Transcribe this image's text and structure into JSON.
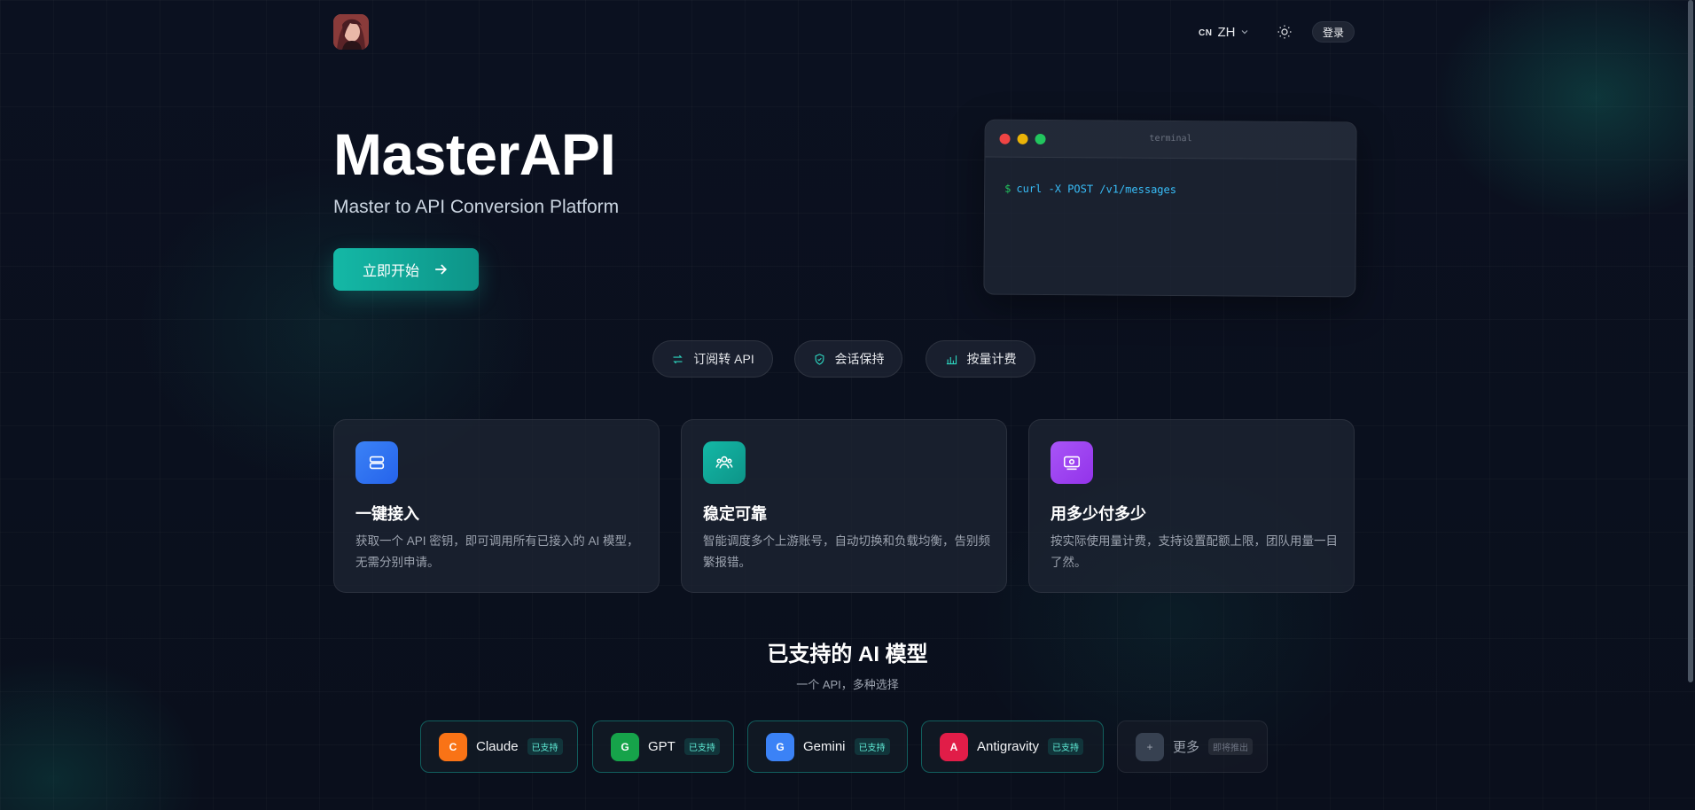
{
  "header": {
    "lang_flag": "CN",
    "lang_code": "ZH",
    "login_label": "登录"
  },
  "hero": {
    "title": "MasterAPI",
    "subtitle": "Master to API Conversion Platform",
    "cta_label": "立即开始"
  },
  "terminal": {
    "title": "terminal",
    "prompt": "$",
    "command": "curl -X POST /v1/messages"
  },
  "pills": [
    {
      "label": "订阅转 API",
      "icon": "swap-icon"
    },
    {
      "label": "会话保持",
      "icon": "shield-check-icon"
    },
    {
      "label": "按量计费",
      "icon": "bar-chart-icon"
    }
  ],
  "features": [
    {
      "title": "一键接入",
      "desc": "获取一个 API 密钥，即可调用所有已接入的 AI 模型，无需分别申请。",
      "icon": "server-icon",
      "color": "#3b82f6"
    },
    {
      "title": "稳定可靠",
      "desc": "智能调度多个上游账号，自动切换和负载均衡，告别频繁报错。",
      "icon": "users-icon",
      "color": "#14b8a6"
    },
    {
      "title": "用多少付多少",
      "desc": "按实际使用量计费，支持设置配额上限，团队用量一目了然。",
      "icon": "wallet-icon",
      "color": "#a855f7"
    }
  ],
  "models": {
    "title": "已支持的 AI 模型",
    "subtitle": "一个 API，多种选择",
    "items": [
      {
        "letter": "C",
        "name": "Claude",
        "badge": "已支持",
        "color": "#f97316"
      },
      {
        "letter": "G",
        "name": "GPT",
        "badge": "已支持",
        "color": "#16a34a"
      },
      {
        "letter": "G",
        "name": "Gemini",
        "badge": "已支持",
        "color": "#3b82f6"
      },
      {
        "letter": "A",
        "name": "Antigravity",
        "badge": "已支持",
        "color": "#e11d48"
      },
      {
        "letter": "+",
        "name": "更多",
        "badge": "即将推出",
        "color": "#374151"
      }
    ]
  }
}
